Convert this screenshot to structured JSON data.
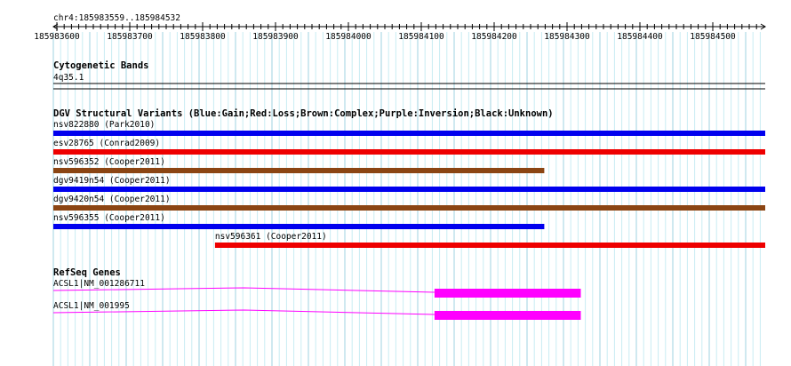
{
  "ruler": {
    "region": "chr4:185983559..185984532",
    "ticks": [
      "185983600",
      "185983700",
      "185983800",
      "185983900",
      "185984000",
      "185984100",
      "185984200",
      "185984300",
      "185984400",
      "185984500"
    ]
  },
  "cytoband": {
    "title": "Cytogenetic Bands",
    "band": "4q35.1"
  },
  "dgv": {
    "title": "DGV Structural Variants (Blue:Gain;Red:Loss;Brown:Complex;Purple:Inversion;Black:Unknown)",
    "colors": {
      "gain": "#0000ee",
      "loss": "#ee0000",
      "complex": "#8b4513"
    },
    "variants": [
      {
        "label": "nsv822880 (Park2010)",
        "type": "gain",
        "start": 185983559,
        "end": 185984532
      },
      {
        "label": "esv28765 (Conrad2009)",
        "type": "loss",
        "start": 185983559,
        "end": 185984532
      },
      {
        "label": "nsv596352 (Cooper2011)",
        "type": "complex",
        "start": 185983559,
        "end": 185984230
      },
      {
        "label": "dgv9419n54 (Cooper2011)",
        "type": "gain",
        "start": 185983559,
        "end": 185984532
      },
      {
        "label": "dgv9420n54 (Cooper2011)",
        "type": "complex",
        "start": 185983559,
        "end": 185984532
      },
      {
        "label": "nsv596355 (Cooper2011)",
        "type": "gain",
        "start": 185983559,
        "end": 185984230
      },
      {
        "label": "nsv596361 (Cooper2011)",
        "type": "loss",
        "start": 185983780,
        "end": 185984532
      }
    ]
  },
  "refseq": {
    "title": "RefSeq Genes",
    "color": "#ff00ff",
    "genes": [
      {
        "label": "ACSL1|NM_001286711",
        "intron_start": 185983559,
        "exon_start": 185984080,
        "exon_end": 185984280
      },
      {
        "label": "ACSL1|NM_001995",
        "intron_start": 185983559,
        "exon_start": 185984080,
        "exon_end": 185984280
      }
    ]
  }
}
